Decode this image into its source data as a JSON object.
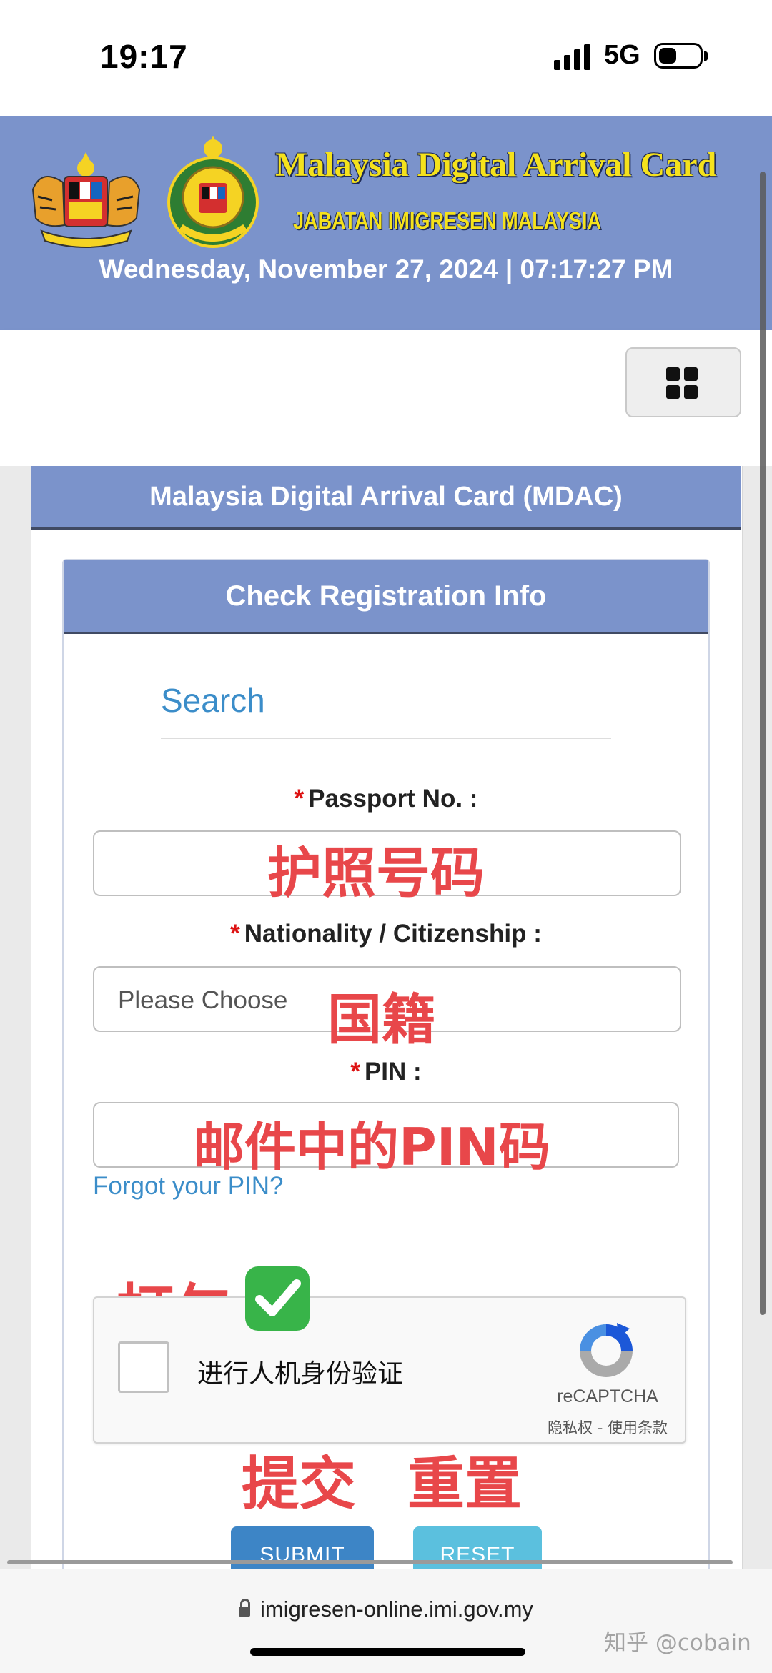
{
  "status_bar": {
    "time": "19:17",
    "network": "5G"
  },
  "header": {
    "title": "Malaysia Digital Arrival Card",
    "subtitle": "JABATAN IMIGRESEN MALAYSIA",
    "datetime": "Wednesday, November 27, 2024 | 07:17:27 PM"
  },
  "nav": {
    "menu_icon": "grid-icon"
  },
  "panel": {
    "title": "Malaysia Digital Arrival Card (MDAC)"
  },
  "card": {
    "title": "Check Registration Info",
    "search_heading": "Search",
    "passport": {
      "required_mark": "*",
      "label": "Passport No. :",
      "value": ""
    },
    "nationality": {
      "required_mark": "*",
      "label": "Nationality / Citizenship :",
      "placeholder": "Please Choose"
    },
    "pin": {
      "required_mark": "*",
      "label": "PIN :",
      "value": ""
    },
    "forgot_link": "Forgot your PIN?",
    "recaptcha": {
      "text": "进行人机身份验证",
      "brand": "reCAPTCHA",
      "links": "隐私权 - 使用条款"
    },
    "submit_label": "SUBMIT",
    "reset_label": "RESET"
  },
  "annotations": {
    "passport": "护照号码",
    "nationality": "国籍",
    "pin": "邮件中的PIN码",
    "check": "打勾",
    "submit": "提交",
    "reset": "重置"
  },
  "browser": {
    "url": "imigresen-online.imi.gov.my"
  },
  "watermark": "知乎 @cobain",
  "colors": {
    "header_bg": "#7b93cb",
    "title_yellow": "#f5e21c",
    "link_blue": "#3b8dc9",
    "annotation_red": "#e8474a",
    "submit_bg": "#3d85c6",
    "reset_bg": "#5bc0de"
  }
}
